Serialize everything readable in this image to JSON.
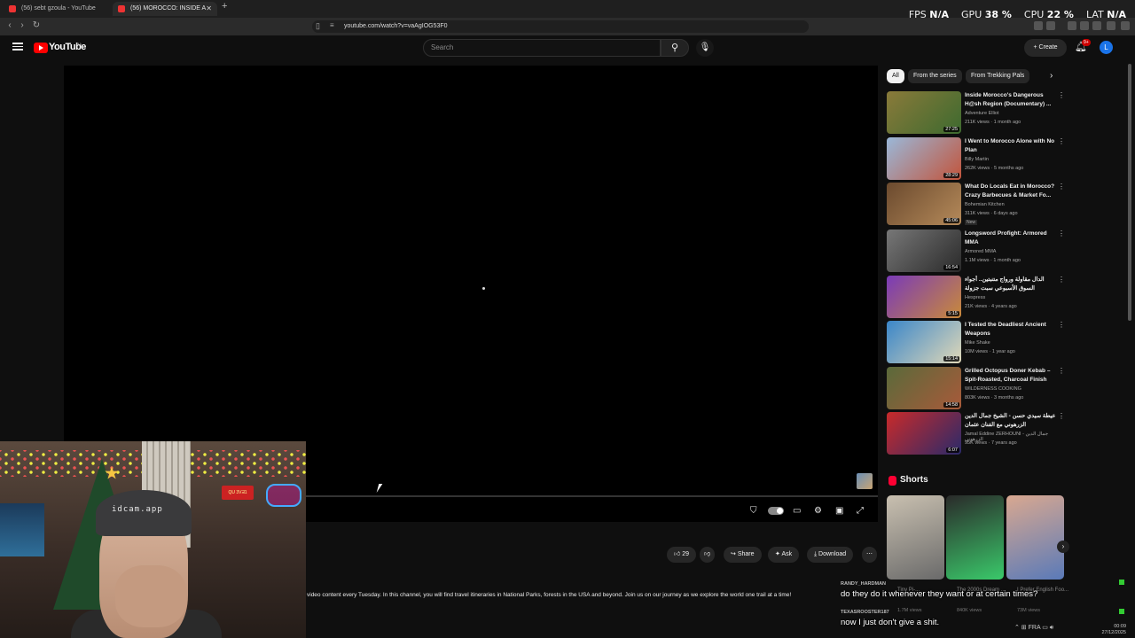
{
  "browser": {
    "tabs": [
      {
        "title": "(56) sebt gzoula - YouTube"
      },
      {
        "title": "(56) MOROCCO: INSIDE A RURA"
      }
    ],
    "url": "youtube.com/watch?v=vaAgIOG53F0"
  },
  "overlay_stats": {
    "fps_label": "FPS",
    "fps_value": "N/A",
    "gpu_label": "GPU",
    "gpu_value": "38 %",
    "cpu_label": "CPU",
    "cpu_value": "22 %",
    "lat_label": "LAT",
    "lat_value": "N/A"
  },
  "header": {
    "logo_text": "YouTube",
    "logo_country": "MA",
    "search_placeholder": "Search",
    "create_label": "Create",
    "notif_count": "9+",
    "avatar_letter": "L"
  },
  "actions": {
    "likes": "29",
    "share": "Share",
    "ask": "Ask",
    "download": "Download"
  },
  "description": "video content every Tuesday. In this channel, you will find travel itineraries in National Parks, forests in the USA and beyond. Join us on our journey as we explore the world one trail at a time!",
  "chips": [
    "All",
    "From the series",
    "From Trekking Pals"
  ],
  "related": [
    {
      "title": "Inside Morocco's Dangerous H@sh Region (Documentary) ...",
      "channel": "Adventure Elliot",
      "meta": "211K views · 1 month ago",
      "duration": "27:25",
      "thumb_a": "#8a7a3a",
      "thumb_b": "#3d6a2f"
    },
    {
      "title": "I Went to Morocco Alone with No Plan",
      "channel": "Billy Martin",
      "meta": "262K views · 5 months ago",
      "duration": "28:29",
      "thumb_a": "#9ab8d9",
      "thumb_b": "#c2543b"
    },
    {
      "title": "What Do Locals Eat in Morocco? Crazy Barbecues & Market Fo...",
      "channel": "Bohemian Kitchen",
      "meta": "311K views · 6 days ago",
      "duration": "45:06",
      "badge": "New",
      "thumb_a": "#6b4a2e",
      "thumb_b": "#b58a5a"
    },
    {
      "title": "Longsword Profight: Armored MMA",
      "channel": "Armored MMA",
      "meta": "1.1M views · 1 month ago",
      "duration": "16:54",
      "thumb_a": "#777777",
      "thumb_b": "#2a2a2a"
    },
    {
      "title": "الدال مقاولة ورواج متنبتين.. أجواء السوق الأسبوعي سبت جزولة",
      "channel": "Hespress",
      "meta": "21K views · 4 years ago",
      "duration": "5:15",
      "thumb_a": "#7a3ab8",
      "thumb_b": "#c98a3a"
    },
    {
      "title": "I Tested the Deadliest Ancient Weapons",
      "channel": "Mike Shake",
      "meta": "10M views · 1 year ago",
      "duration": "15:14",
      "thumb_a": "#3a86c9",
      "thumb_b": "#e0d8b8"
    },
    {
      "title": "Grilled Octopus Doner Kebab – Spit-Roasted, Charcoal Finish",
      "channel": "WILDERNESS COOKING",
      "meta": "803K views · 3 months ago",
      "duration": "14:58",
      "thumb_a": "#5a6a3a",
      "thumb_b": "#a85a3a"
    },
    {
      "title": "عيطة سيدي حسن - الشيخ جمال الدين الزرهوني مع الفنان عثمان",
      "channel": "Jamal Eddine ZERHOUNI - جمال الدين الزرهوني",
      "meta": "95K views · 7 years ago",
      "duration": "6:07",
      "thumb_a": "#c92a2a",
      "thumb_b": "#2a2a6a"
    }
  ],
  "shorts": {
    "heading": "Shorts",
    "items": [
      {
        "title": "Tiny Pi-...",
        "views": "1.7M views",
        "thumb_a": "#c9c0b0",
        "thumb_b": "#6a6a6a"
      },
      {
        "title": "The 2000s Dream ...",
        "views": "840K views",
        "thumb_a": "#2a2a2a",
        "thumb_b": "#3ac96a"
      },
      {
        "title": "I Prefer English Foo...",
        "views": "73M views",
        "thumb_a": "#d9a890",
        "thumb_b": "#5a7ab8"
      }
    ]
  },
  "webcam": {
    "watermark": "idcam.app",
    "sign": "QU 3VƎ1"
  },
  "chat": [
    {
      "user": "RANDY_HARDMAN",
      "message": "do they do it whenever they want or at certain times?"
    },
    {
      "user": "TEXASROOSTER187",
      "message": "now I just don't give a shit."
    }
  ],
  "tray": {
    "lang": "FRA",
    "time": "00:09",
    "date": "27/12/2025"
  },
  "colors": {
    "yt_red": "#ff0000",
    "bg": "#0f0f0f",
    "chip_bg": "#272727"
  }
}
